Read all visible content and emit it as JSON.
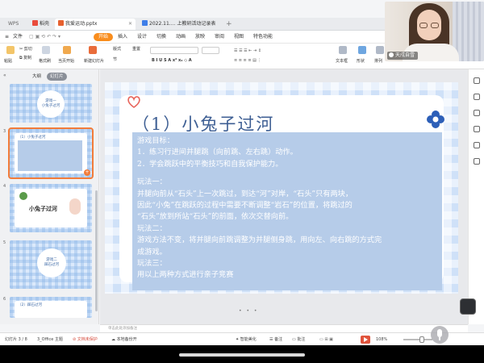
{
  "tabs": {
    "wps": "WPS",
    "shell": "稻壳",
    "doc": "我爱运动.pptx",
    "doc2": "2022.11.... 上教研活动记录表"
  },
  "menu": {
    "file": "文件",
    "start": "开始",
    "items": [
      "插入",
      "设计",
      "切换",
      "动画",
      "放映",
      "审阅",
      "视图",
      "特色功能"
    ]
  },
  "ribbon": {
    "paste": "粘贴",
    "cut": "剪切",
    "copy": "复制",
    "format_painter": "格式刷",
    "play_from_current": "当页开始",
    "new_slide": "新建幻灯片",
    "layout": "版式",
    "section": "节",
    "reset": "重置",
    "text_box": "文本框",
    "shape": "形状",
    "arrange": "排列",
    "accent": "#f98d1d"
  },
  "panel": {
    "tab_outline": "大纲",
    "tab_slides": "幻灯片",
    "thumbs": [
      {
        "num": "",
        "label": "游戏一\n小兔子过河"
      },
      {
        "num": "3",
        "label": "（1）小兔子过河"
      },
      {
        "num": "4",
        "label": "小兔子过河"
      },
      {
        "num": "5",
        "label": "游戏二\n踩石过河"
      },
      {
        "num": "6",
        "label": "（2）踩石过河"
      }
    ],
    "add": "+"
  },
  "slide": {
    "title": "（1）小兔子过河",
    "lines": [
      "游戏目标：",
      "1．练习行进间并腿跳（向前跳、左右跳）动作。",
      "2．学会跳跃中的平衡技巧和自我保护能力。",
      "玩法一：",
      "并腿向前从“石头”上一次跳过，到达“河”对岸，“石头”只有两块，",
      "因此“小兔”在跳跃的过程中需要不断调整“岩石”的位置，将跳过的",
      "“石头”放到所站“石头”的前面，依次交替向前。",
      "玩法二：",
      "游戏方法不变，将并腿向前跳调整为并腿侧身跳，用向左、向右跳的方式完",
      "成游戏。",
      "玩法三：",
      "用以上两种方式进行亲子竞赛"
    ],
    "pager": "• • •"
  },
  "notes": "单击此处添加备注",
  "status": {
    "slide_count": "幻灯片 3 / 8",
    "theme": "3_Office 主题",
    "protect": "文档未保护",
    "backup": "本地备份开",
    "smart_beautify": "智能美化",
    "notes_btn": "备注",
    "comment_btn": "批注",
    "zoom": "108%"
  },
  "video": {
    "name": "天戍自雪"
  }
}
